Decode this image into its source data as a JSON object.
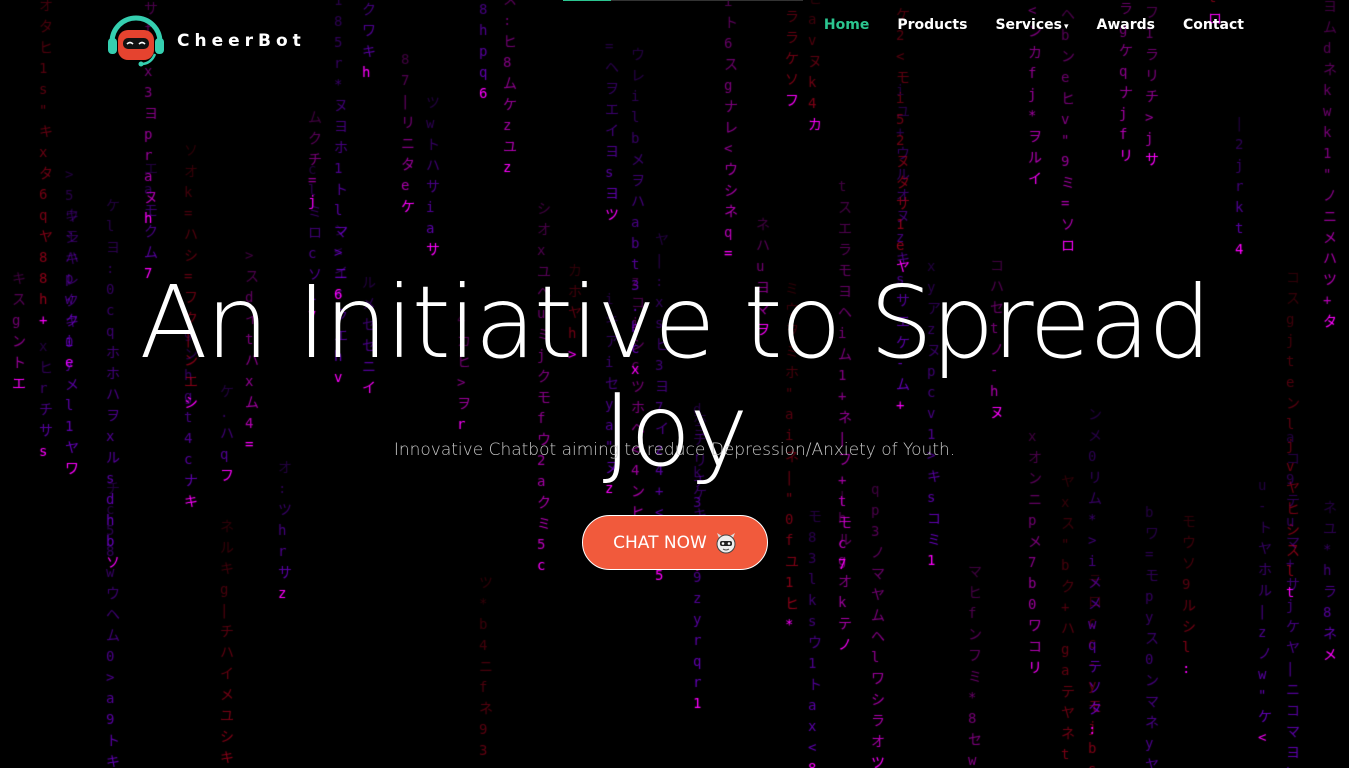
{
  "brand": {
    "name": "CheerBot",
    "logo_icon": "robot-headset-icon"
  },
  "nav": {
    "home": "Home",
    "products": "Products",
    "services": "Services",
    "awards": "Awards",
    "contact": "Contact",
    "active": "Home"
  },
  "hero": {
    "title_line1": "An Initiative to Spread",
    "title_line2": "Joy",
    "subtitle": "Innovative Chatbot aiming to reduce Depression/Anxiety of Youth.",
    "cta_label": "CHAT NOW",
    "cta_icon": "robot-face-icon"
  },
  "top_progress": {
    "fraction": 0.2
  },
  "colors": {
    "accent": "#2bc590",
    "cta": "#f15a3c",
    "rain_pink": "#ff00ff",
    "rain_purple": "#8a00ff",
    "rain_red": "#c00020"
  },
  "background": {
    "type": "matrix-rain",
    "glyphs": "abcdefghijklpqrstuvwxyz0123456789アイウエオカキクケコサシスセソタチツテトナニヌネノハヒフヘホマミムメモヤユヨラリルレロワヲン:=*+-<>|\"."
  }
}
